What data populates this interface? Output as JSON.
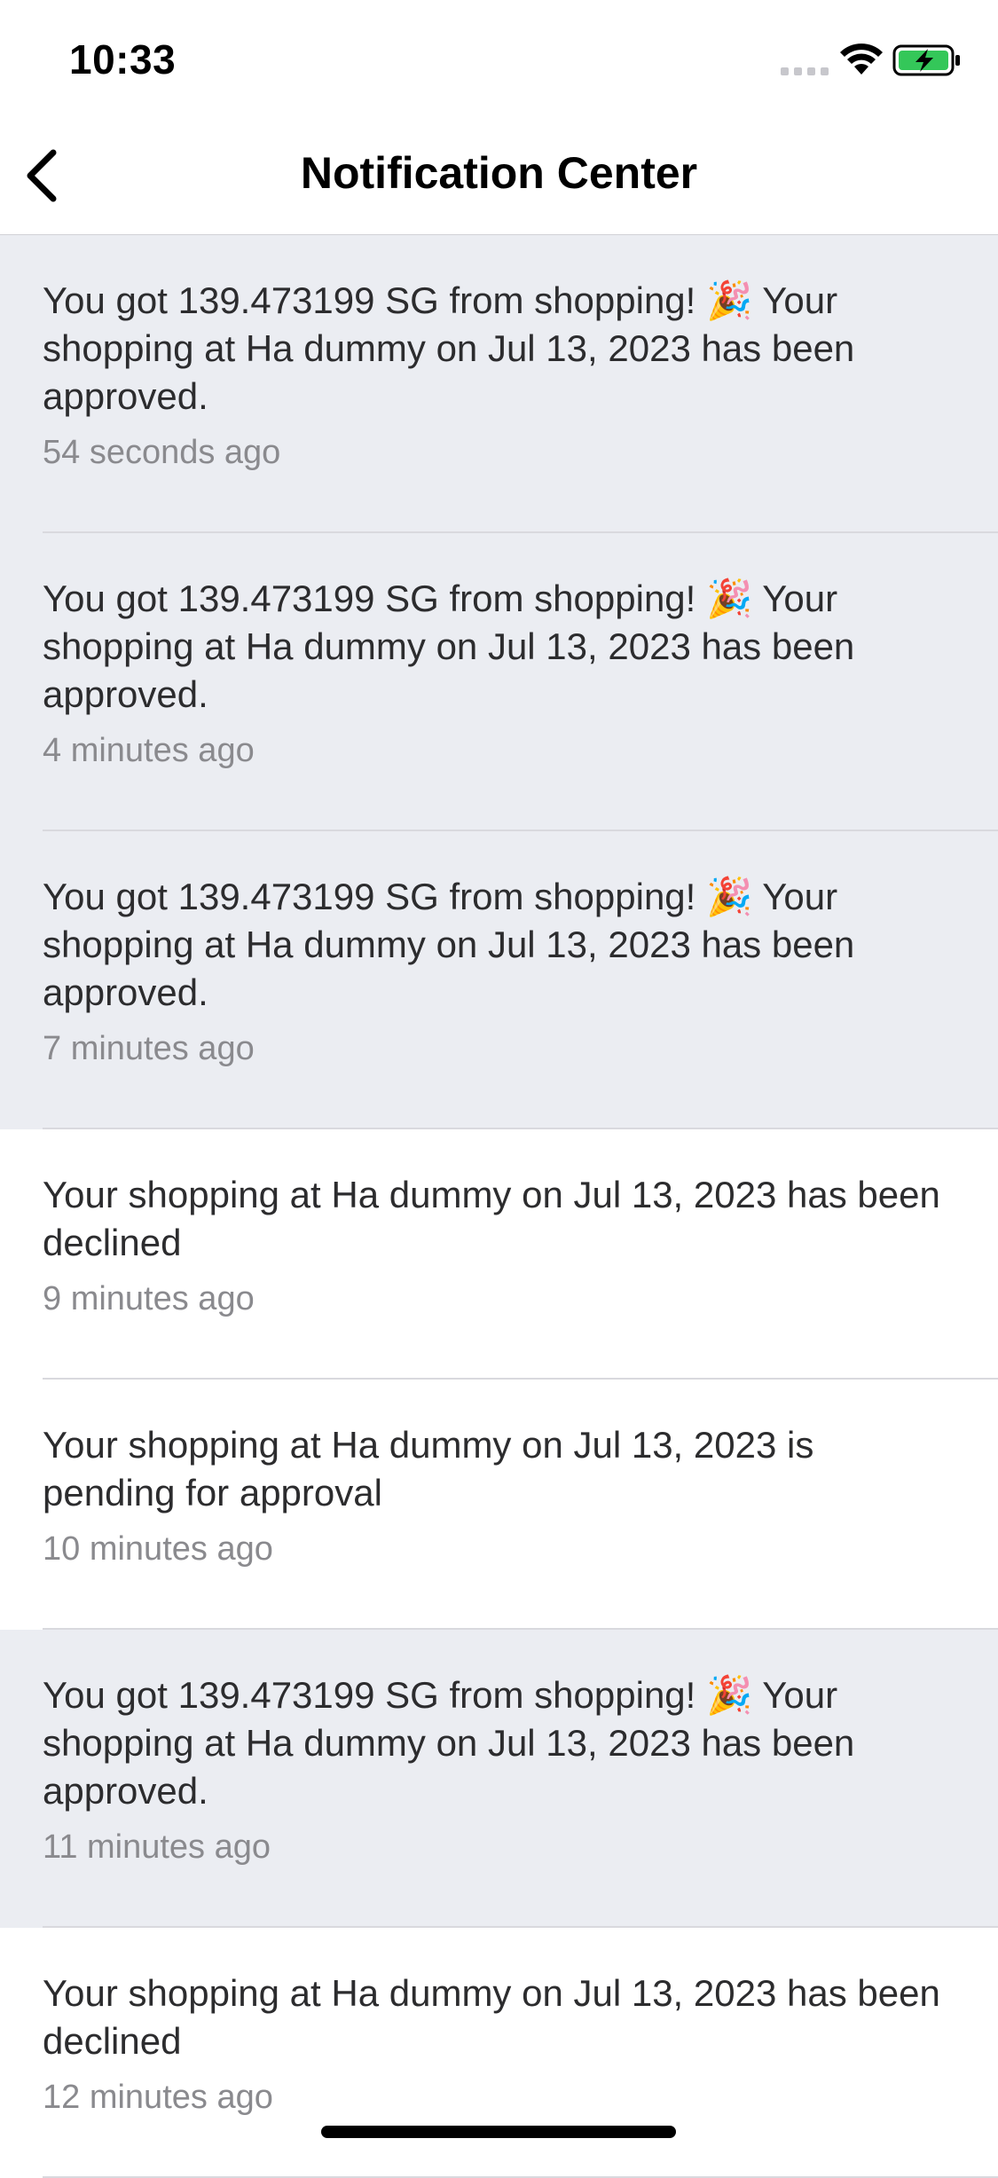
{
  "status_bar": {
    "time": "10:33"
  },
  "nav": {
    "title": "Notification Center"
  },
  "notifications": [
    {
      "message": "You got 139.473199 SG from shopping! 🎉 Your shopping at Ha dummy on Jul 13, 2023 has been approved.",
      "time": "54 seconds ago",
      "unread": true
    },
    {
      "message": "You got 139.473199 SG from shopping! 🎉 Your shopping at Ha dummy on Jul 13, 2023 has been approved.",
      "time": "4 minutes ago",
      "unread": true
    },
    {
      "message": "You got 139.473199 SG from shopping! 🎉 Your shopping at Ha dummy on Jul 13, 2023 has been approved.",
      "time": "7 minutes ago",
      "unread": true
    },
    {
      "message": "Your shopping at Ha dummy on Jul 13, 2023 has been declined",
      "time": "9 minutes ago",
      "unread": false
    },
    {
      "message": "Your shopping at Ha dummy on Jul 13, 2023 is pending for approval",
      "time": "10 minutes ago",
      "unread": false
    },
    {
      "message": "You got 139.473199 SG from shopping! 🎉 Your shopping at Ha dummy on Jul 13, 2023 has been approved.",
      "time": "11 minutes ago",
      "unread": true
    },
    {
      "message": "Your shopping at Ha dummy on Jul 13, 2023 has been declined",
      "time": "12 minutes ago",
      "unread": false
    }
  ],
  "colors": {
    "unread_background": "#ebedf2",
    "read_background": "#ffffff",
    "battery_green": "#34c759"
  },
  "icons": {
    "back": "chevron-left-icon",
    "signal": "cellular-signal-icon",
    "wifi": "wifi-icon",
    "battery": "battery-charging-icon"
  }
}
